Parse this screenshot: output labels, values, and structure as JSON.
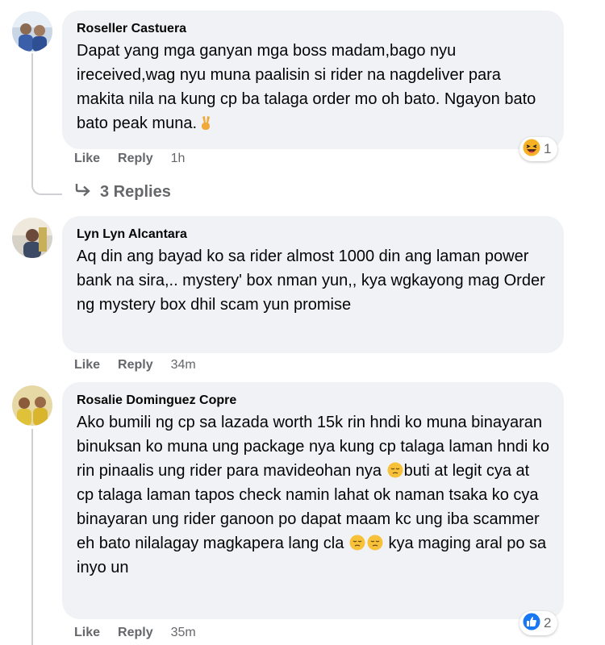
{
  "comments": [
    {
      "author": "Roseller Castuera",
      "text": "Dapat yang mga ganyan mga boss madam,bago nyu ireceived,wag nyu muna paalisin si rider na nagdeliver para makita nila na kung cp ba talaga order mo oh bato. Ngayon bato bato peak muna.",
      "text_emoji": "victory-hand",
      "like_label": "Like",
      "reply_label": "Reply",
      "time": "1h",
      "reaction_icon": "haha-icon",
      "reaction_count": "1",
      "replies_label": "3 Replies"
    },
    {
      "author": "Lyn Lyn Alcantara",
      "text": "Aq din ang bayad ko sa rider almost 1000 din ang laman power bank na sira,.. mystery' box nman yun,, kya wgkayong mag Order ng mystery box dhil scam yun promise",
      "like_label": "Like",
      "reply_label": "Reply",
      "time": "34m"
    },
    {
      "author": "Rosalie Dominguez Copre",
      "text_part1": "Ako bumili ng cp sa lazada worth 15k rin hndi ko muna binayaran binuksan ko muna ung package nya kung cp talaga laman hndi ko rin pinaalis ung rider para mavideohan nya",
      "text_part2": "buti at legit cya at cp talaga laman tapos check namin lahat ok naman tsaka ko cya binayaran ung rider ganoon po dapat maam kc ung iba scammer eh bato nilalagay magkapera lang cla",
      "text_part3": "kya maging aral po sa inyo un",
      "text_emoji": "pensive-face",
      "like_label": "Like",
      "reply_label": "Reply",
      "time": "35m",
      "reaction_icon": "like-icon",
      "reaction_count": "2"
    }
  ],
  "colors": {
    "bubble": "#f0f2f5",
    "secondary_text": "#65676b",
    "like_blue": "#1877f2",
    "haha_yellow": "#f7b125"
  }
}
